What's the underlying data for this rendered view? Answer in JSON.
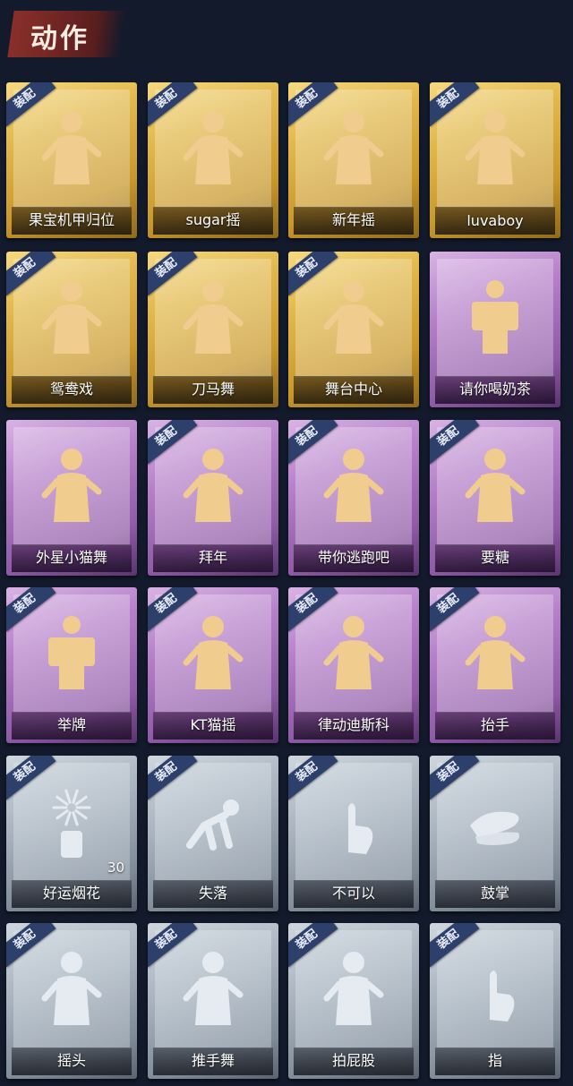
{
  "header": {
    "title": "动作"
  },
  "equip_label": "装配",
  "colors": {
    "gold": "#e2b94c",
    "purple": "#b57fc9",
    "silver": "#a7b2be",
    "badge": "#2d3f6b",
    "figure_gold": "#f1cc8f",
    "figure_silver": "#e6ebf2"
  },
  "cards": [
    {
      "label": "果宝机甲归位",
      "tier": "gold",
      "equipped": true,
      "icon": "dance-figure-icon"
    },
    {
      "label": "sugar摇",
      "tier": "gold",
      "equipped": true,
      "icon": "dance-figure-icon"
    },
    {
      "label": "新年摇",
      "tier": "gold",
      "equipped": true,
      "icon": "dance-figure-icon"
    },
    {
      "label": "luvaboy",
      "tier": "gold",
      "equipped": true,
      "icon": "dance-figure-icon"
    },
    {
      "label": "鸳鸯戏",
      "tier": "gold",
      "equipped": true,
      "icon": "dance-figure-icon"
    },
    {
      "label": "刀马舞",
      "tier": "gold",
      "equipped": true,
      "icon": "dance-figure-icon"
    },
    {
      "label": "舞台中心",
      "tier": "gold",
      "equipped": true,
      "icon": "dance-figure-icon"
    },
    {
      "label": "请你喝奶茶",
      "tier": "purple",
      "equipped": false,
      "icon": "sign-figure-icon"
    },
    {
      "label": "外星小猫舞",
      "tier": "purple",
      "equipped": false,
      "icon": "dance-figure-icon"
    },
    {
      "label": "拜年",
      "tier": "purple",
      "equipped": true,
      "icon": "bow-figure-icon"
    },
    {
      "label": "带你逃跑吧",
      "tier": "purple",
      "equipped": true,
      "icon": "dance-figure-icon"
    },
    {
      "label": "要糖",
      "tier": "purple",
      "equipped": true,
      "icon": "reach-figure-icon"
    },
    {
      "label": "举牌",
      "tier": "purple",
      "equipped": true,
      "icon": "sign-figure-icon"
    },
    {
      "label": "KT猫摇",
      "tier": "purple",
      "equipped": true,
      "icon": "dance-figure-icon"
    },
    {
      "label": "律动迪斯科",
      "tier": "purple",
      "equipped": true,
      "icon": "dance-figure-icon"
    },
    {
      "label": "抬手",
      "tier": "purple",
      "equipped": true,
      "icon": "reach-figure-icon"
    },
    {
      "label": "好运烟花",
      "tier": "silver",
      "equipped": true,
      "icon": "firework-icon",
      "count": "30"
    },
    {
      "label": "失落",
      "tier": "silver",
      "equipped": true,
      "icon": "crawl-figure-icon"
    },
    {
      "label": "不可以",
      "tier": "silver",
      "equipped": true,
      "icon": "finger-icon"
    },
    {
      "label": "鼓掌",
      "tier": "silver",
      "equipped": true,
      "icon": "clap-icon"
    },
    {
      "label": "摇头",
      "tier": "silver",
      "equipped": true,
      "icon": "dance-figure-icon"
    },
    {
      "label": "推手舞",
      "tier": "silver",
      "equipped": true,
      "icon": "dance-figure-icon"
    },
    {
      "label": "拍屁股",
      "tier": "silver",
      "equipped": true,
      "icon": "dance-figure-icon"
    },
    {
      "label": "指",
      "tier": "silver",
      "equipped": true,
      "icon": "point-icon"
    }
  ]
}
